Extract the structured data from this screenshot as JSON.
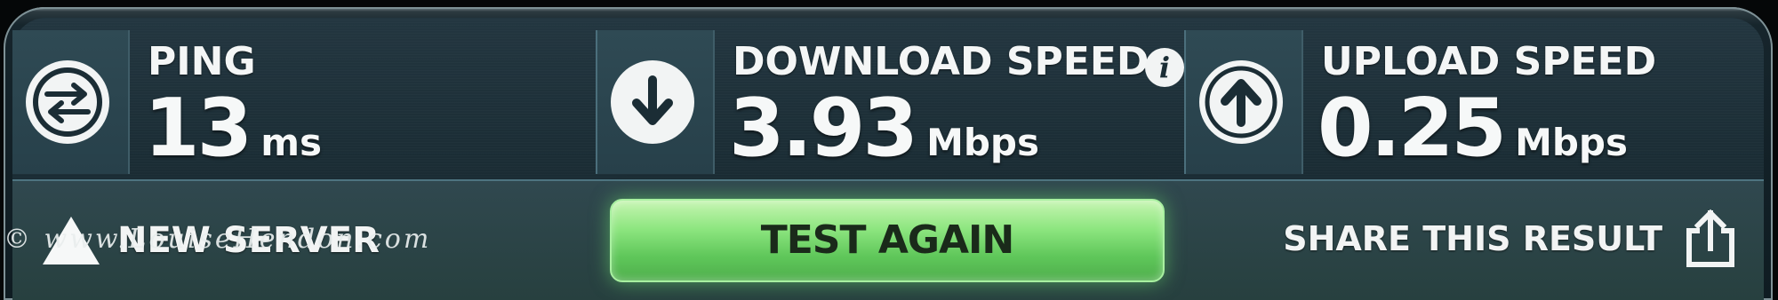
{
  "ping": {
    "label": "PING",
    "value": "13",
    "unit": "ms",
    "icon": "ping-arrows-icon"
  },
  "download": {
    "label": "DOWNLOAD SPEED",
    "value": "3.93",
    "unit": "Mbps",
    "icon": "download-arrow-icon",
    "info_icon": "info-icon"
  },
  "upload": {
    "label": "UPLOAD SPEED",
    "value": "0.25",
    "unit": "Mbps",
    "icon": "upload-arrow-icon"
  },
  "actions": {
    "new_server_label": "NEW SERVER",
    "test_again_label": "TEST AGAIN",
    "share_label": "SHARE THIS RESULT"
  },
  "watermark": "© www.LouiseHendon.com",
  "colors": {
    "accent_green": "#8ee680",
    "panel_bg": "#1b2d35",
    "text": "#f4f6f6"
  }
}
